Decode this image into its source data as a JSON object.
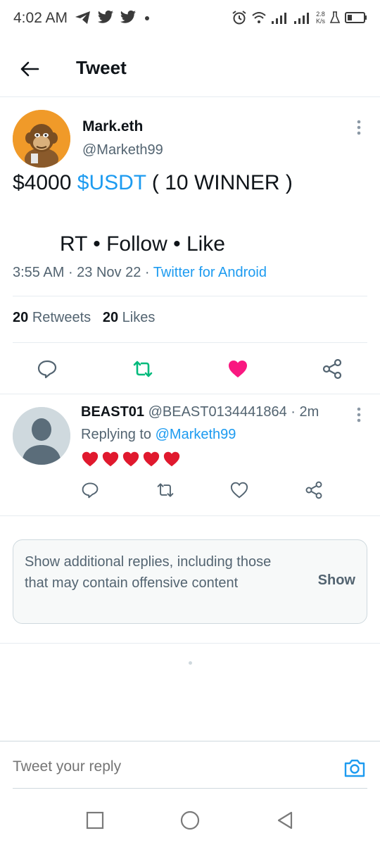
{
  "status_bar": {
    "time": "4:02 AM",
    "left_icons": [
      "telegram-icon",
      "twitter-icon",
      "twitter-icon",
      "dot-icon"
    ],
    "net_speed_value": "2.8",
    "net_speed_unit": "K/s",
    "right_icons": [
      "alarm-icon",
      "wifi-icon",
      "signal-icon",
      "signal-icon",
      "lab-icon",
      "battery-icon"
    ]
  },
  "header": {
    "title": "Tweet"
  },
  "tweet": {
    "author_name": "Mark.eth",
    "author_handle": "@Marketh99",
    "text_amount": "$4000 ",
    "text_cashtag": "$USDT",
    "text_rest": " ( 10 WINNER )",
    "text_line2": "RT • Follow • Like",
    "time": "3:55 AM",
    "date": "23 Nov 22",
    "source": "Twitter for Android",
    "retweets_count": "20",
    "retweets_label": "Retweets",
    "likes_count": "20",
    "likes_label": "Likes",
    "liked": true
  },
  "reply": {
    "author_name": "BEAST01",
    "author_handle": "@BEAST0134441864",
    "age": "2m",
    "replying_label": "Replying to ",
    "replying_to": "@Marketh99",
    "hearts_count": 5
  },
  "more_replies": {
    "text": "Show additional replies, including those that may contain offensive content",
    "button": "Show"
  },
  "composer": {
    "placeholder": "Tweet your reply"
  },
  "colors": {
    "accent": "#1d9bf0",
    "retweet": "#00ba7c",
    "like": "#f91880",
    "muted": "#536471",
    "avatar_orange": "#f09a29"
  }
}
